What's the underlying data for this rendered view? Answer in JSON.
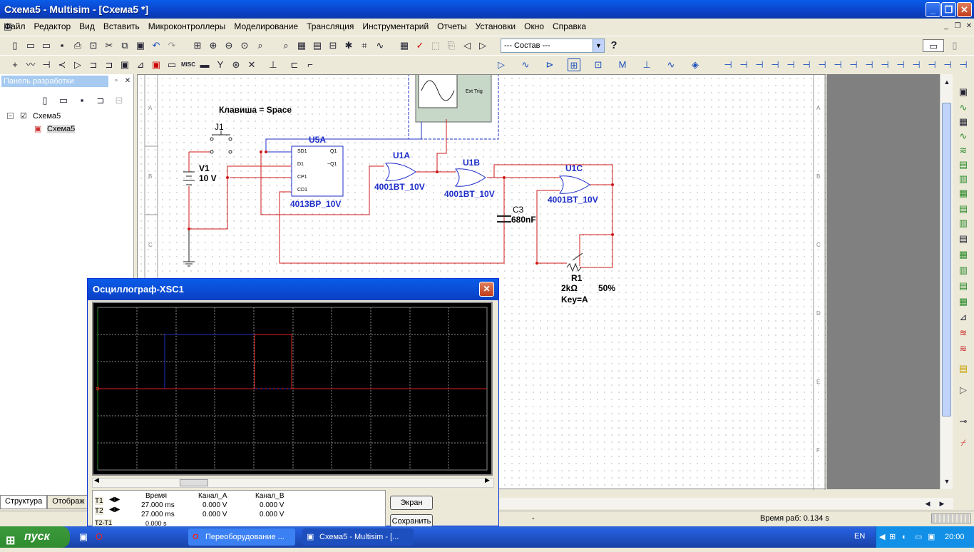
{
  "window": {
    "title": "Схема5 - Multisim - [Схема5 *]"
  },
  "menu": [
    "Файл",
    "Редактор",
    "Вид",
    "Вставить",
    "Микроконтроллеры",
    "Моделирование",
    "Трансляция",
    "Инструментарий",
    "Отчеты",
    "Установки",
    "Окно",
    "Справка"
  ],
  "toolbar": {
    "combo_value": "--- Состав ---",
    "help": "?",
    "misc": "MISC"
  },
  "panel": {
    "title": "Панель разработки",
    "tree_root": "Схема5",
    "tree_child": "Схема5",
    "tabs": [
      "Структура",
      "Отображ"
    ]
  },
  "schematic": {
    "key_note": "Клавиша = Space",
    "j1": "J1",
    "v1": "V1",
    "v1_val": "10 V",
    "u5a": "U5A",
    "u5a_part": "4013BP_10V",
    "u1a": "U1A",
    "u1a_part": "4001BT_10V",
    "u1b": "U1B",
    "u1b_part": "4001BT_10V",
    "u1c": "U1C",
    "u1c_part": "4001BT_10V",
    "c3": "C3",
    "c3_val": "680nF",
    "r1": "R1",
    "r1_val": "2kΩ",
    "r1_pct": "50%",
    "r1_key": "Key=A",
    "ext_trig": "Ext Trig",
    "pins": [
      "SD1",
      "D1",
      "CP1",
      "CD1",
      "Q1",
      "~Q1"
    ],
    "border_rows": [
      "A",
      "B",
      "C"
    ],
    "border_rows_right": [
      "A",
      "B",
      "C",
      "D",
      "E",
      "F"
    ]
  },
  "oscilloscope": {
    "title": "Осциллограф-XSC1",
    "headers": [
      "Время",
      "Канал_A",
      "Канал_B"
    ],
    "rows": [
      {
        "label": "T1",
        "time": "27.000 ms",
        "a": "0.000 V",
        "b": "0.000 V"
      },
      {
        "label": "T2",
        "time": "27.000 ms",
        "a": "0.000 V",
        "b": "0.000 V"
      },
      {
        "label": "T2-T1",
        "time": "0.000 s",
        "a": "",
        "b": ""
      }
    ],
    "btn_screen": "Экран",
    "btn_save": "Сохранить"
  },
  "status": {
    "dash": "-",
    "run_time": "Время раб: 0.134 s"
  },
  "taskbar": {
    "start": "пуск",
    "tasks": [
      "Переоборудование ...",
      "Схема5 - Multisim - [..."
    ],
    "lang": "EN",
    "clock": "20:00"
  },
  "colors": {
    "wire_red": "#d01818",
    "wire_blue": "#1e2ec8",
    "trace_blue": "#2030c0",
    "trace_red": "#e02020"
  }
}
